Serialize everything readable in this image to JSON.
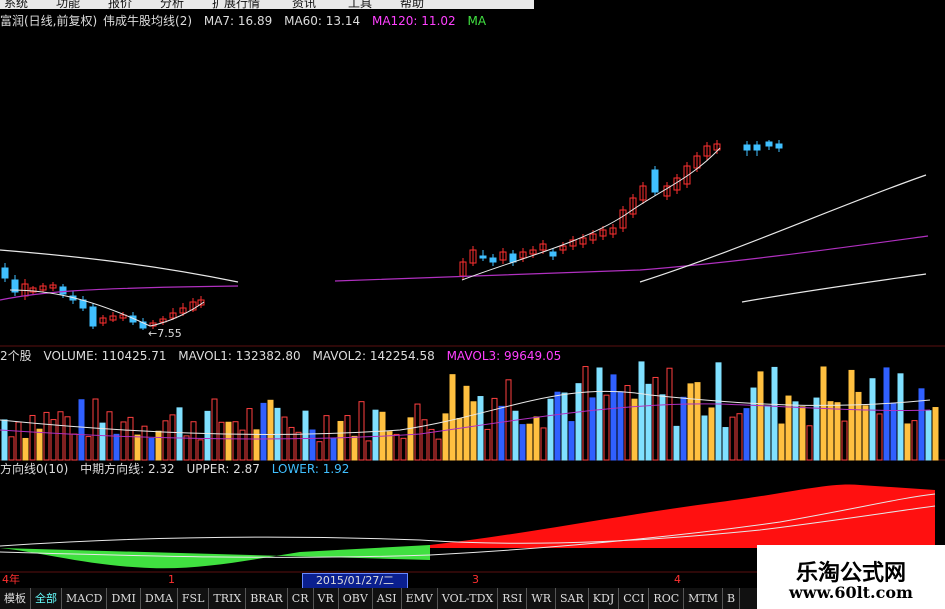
{
  "menu": [
    "系统",
    "功能",
    "报价",
    "分析",
    "扩展行情",
    "资讯",
    "工具",
    "帮助"
  ],
  "price_panel": {
    "title_left": "富润(日线,前复权)",
    "indicator_name": "伟成牛股均线(2)",
    "ma7": "MA7: 16.89",
    "ma60": "MA60: 13.14",
    "ma120": "MA120: 11.02",
    "ma_last": "MA",
    "low_marker": "←7.55"
  },
  "volume_panel": {
    "prefix": "2个股",
    "volume": "VOLUME: 110425.71",
    "mavol1": "MAVOL1: 132382.80",
    "mavol2": "MAVOL2: 142254.58",
    "mavol3": "MAVOL3: 99649.05"
  },
  "direction_panel": {
    "prefix": "方向线0(10)",
    "mid": "中期方向线: 2.32",
    "upper": "UPPER: 2.87",
    "lower": "LOWER: 1.92"
  },
  "time_axis": {
    "labels": [
      "4年",
      "1",
      "3",
      "4"
    ],
    "selected_date": "2015/01/27/二"
  },
  "tabs": [
    "模板",
    "全部",
    "MACD",
    "DMI",
    "DMA",
    "FSL",
    "TRIX",
    "BRAR",
    "CR",
    "VR",
    "OBV",
    "ASI",
    "EMV",
    "VOL-TDX",
    "RSI",
    "WR",
    "SAR",
    "KDJ",
    "CCI",
    "ROC",
    "MTM",
    "B"
  ],
  "watermark": {
    "title": "乐淘公式网",
    "url": "www.60lt.com"
  },
  "colors": {
    "background": "#000000",
    "up_candle": "#ff3030",
    "down_candle": "#40c0ff",
    "ma_white": "#e8e8e8",
    "ma_purple": "#b030c0",
    "ma120_color": "#ff40ff",
    "mavol3_color": "#ff40ff",
    "vol_yellow": "#ffc040",
    "vol_cyan": "#80e0ff",
    "vol_blue": "#3060ff",
    "vol_red": "#ff4040",
    "lower_color": "#40c0ff",
    "area_red": "#ff1010",
    "area_green": "#40e040"
  }
}
